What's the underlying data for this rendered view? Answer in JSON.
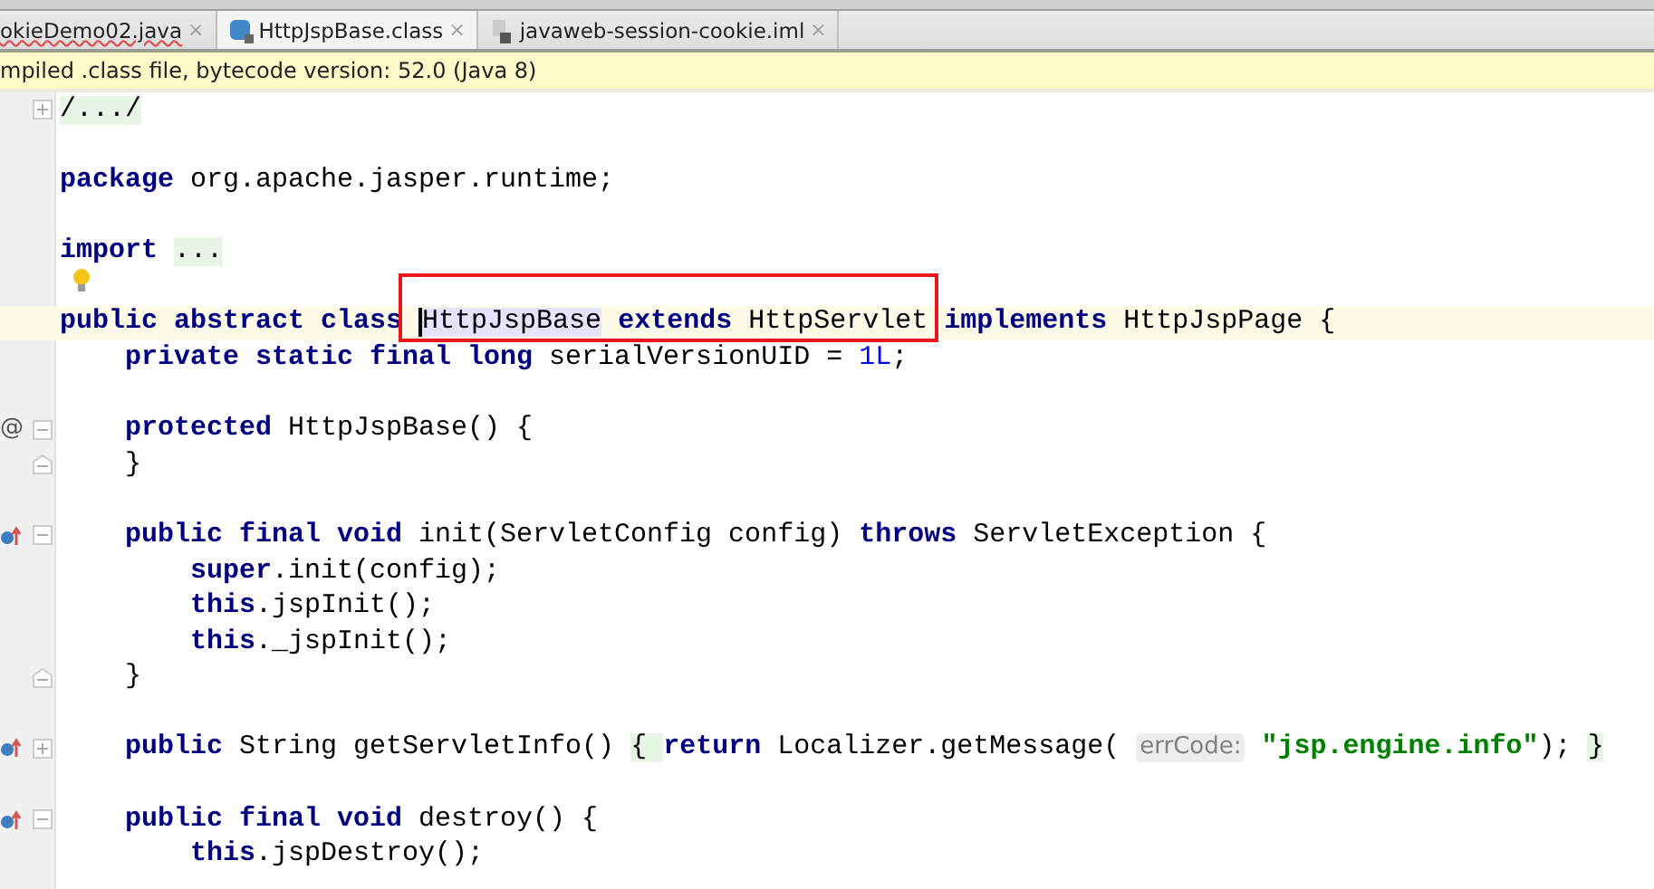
{
  "tabs": [
    {
      "kind": "java",
      "label": "okieDemo02.java",
      "close": "×",
      "selected": false,
      "misspelled": true
    },
    {
      "kind": "class",
      "label": "HttpJspBase.class",
      "close": "×",
      "selected": true,
      "misspelled": false
    },
    {
      "kind": "module",
      "label": "javaweb-session-cookie.iml",
      "close": "×",
      "selected": false,
      "misspelled": false
    }
  ],
  "banner": "mpiled .class file, bytecode version: 52.0 (Java 8)",
  "lines": [
    {
      "kind": "code",
      "expanded": false,
      "tokens": [
        {
          "kind": "folded",
          "text": "/.../"
        }
      ]
    },
    {
      "kind": "blank"
    },
    {
      "kind": "code",
      "tokens": [
        {
          "kind": "kw",
          "text": "package"
        },
        {
          "kind": "plain",
          "text": " org.apache.jasper.runtime;"
        }
      ]
    },
    {
      "kind": "blank"
    },
    {
      "kind": "code",
      "tokens": [
        {
          "kind": "kw",
          "text": "import "
        },
        {
          "kind": "folded",
          "text": "..."
        }
      ]
    },
    {
      "kind": "blank",
      "bulb": true
    },
    {
      "kind": "code",
      "current": true,
      "tokens": [
        {
          "kind": "kw",
          "text": "public abstract class "
        },
        {
          "kind": "ident",
          "text": "HttpJspBase"
        },
        {
          "kind": "kw",
          "text": " extends"
        },
        {
          "kind": "plain",
          "text": " HttpServlet "
        },
        {
          "kind": "kw",
          "text": "implements"
        },
        {
          "kind": "plain",
          "text": " HttpJspPage {"
        }
      ],
      "children": [
        {
          "kind": "code",
          "tokens": [
            {
              "kind": "kw",
              "text": "private static final long"
            },
            {
              "kind": "plain",
              "text": " serialVersionUID = "
            },
            {
              "kind": "num",
              "text": "1L"
            },
            {
              "kind": "plain",
              "text": ";"
            }
          ]
        },
        {
          "kind": "blank"
        },
        {
          "kind": "code",
          "gutter_text": "@",
          "expanded": true,
          "tokens": [
            {
              "kind": "kw",
              "text": "protected"
            },
            {
              "kind": "plain",
              "text": " HttpJspBase() {"
            }
          ]
        },
        {
          "kind": "code",
          "fold_end": true,
          "tokens": [
            {
              "kind": "plain",
              "text": "}"
            }
          ]
        },
        {
          "kind": "blank"
        },
        {
          "kind": "code",
          "overrides": true,
          "expanded": true,
          "tokens": [
            {
              "kind": "kw",
              "text": "public final void"
            },
            {
              "kind": "plain",
              "text": " init(ServletConfig config) "
            },
            {
              "kind": "kw",
              "text": "throws"
            },
            {
              "kind": "plain",
              "text": " ServletException {"
            }
          ],
          "children": [
            {
              "kind": "code",
              "tokens": [
                {
                  "kind": "kw",
                  "text": "super"
                },
                {
                  "kind": "plain",
                  "text": ".init(config);"
                }
              ]
            },
            {
              "kind": "code",
              "tokens": [
                {
                  "kind": "kw",
                  "text": "this"
                },
                {
                  "kind": "plain",
                  "text": ".jspInit();"
                }
              ]
            },
            {
              "kind": "code",
              "tokens": [
                {
                  "kind": "kw",
                  "text": "this"
                },
                {
                  "kind": "plain",
                  "text": "._jspInit();"
                }
              ]
            }
          ]
        },
        {
          "kind": "code",
          "fold_end": true,
          "tokens": [
            {
              "kind": "plain",
              "text": "}"
            }
          ]
        },
        {
          "kind": "blank"
        },
        {
          "kind": "code",
          "overrides": true,
          "expanded": false,
          "tokens": [
            {
              "kind": "kw",
              "text": "public"
            },
            {
              "kind": "plain",
              "text": " String getServletInfo() "
            },
            {
              "kind": "folded",
              "text": "{ "
            },
            {
              "kind": "kw",
              "text": "return"
            },
            {
              "kind": "plain",
              "text": " Localizer.getMessage( "
            },
            {
              "kind": "hint",
              "text": "errCode:"
            },
            {
              "kind": "str",
              "text": " \"jsp.engine.info\""
            },
            {
              "kind": "plain",
              "text": "); "
            },
            {
              "kind": "folded",
              "text": "}"
            }
          ]
        },
        {
          "kind": "blank"
        },
        {
          "kind": "code",
          "overrides": true,
          "expanded": true,
          "tokens": [
            {
              "kind": "kw",
              "text": "public final void"
            },
            {
              "kind": "plain",
              "text": " destroy() {"
            }
          ],
          "children": [
            {
              "kind": "code",
              "tokens": [
                {
                  "kind": "kw",
                  "text": "this"
                },
                {
                  "kind": "plain",
                  "text": ".jspDestroy();"
                }
              ]
            }
          ]
        }
      ]
    }
  ]
}
